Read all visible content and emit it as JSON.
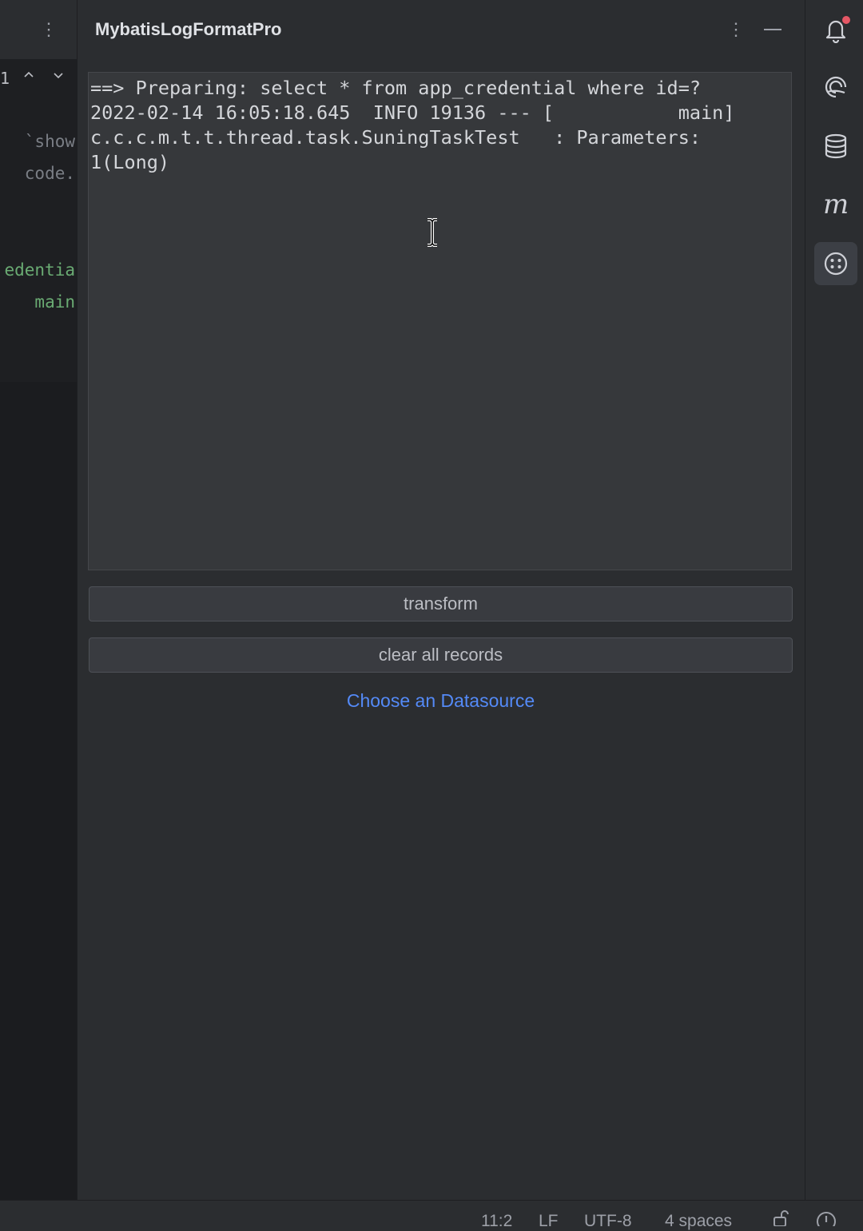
{
  "tool_window": {
    "title": "MybatisLogFormatPro"
  },
  "log_input": {
    "lines": [
      "==> Preparing: select * from app_credential where id=?",
      "2022-02-14 16:05:18.645  INFO 19136 --- [           main]",
      "c.c.c.m.t.t.thread.task.SuningTaskTest   : Parameters:",
      "1(Long)"
    ]
  },
  "buttons": {
    "transform": "transform",
    "clear": "clear all records"
  },
  "datasource_link": "Choose an Datasource",
  "editor_fragment": {
    "search_count": "1",
    "lines": [
      "`show",
      "code.",
      "edentia",
      "main"
    ]
  },
  "status_bar": {
    "position": "11:2",
    "line_ending": "LF",
    "encoding": "UTF-8",
    "indent": "4 spaces"
  },
  "right_stripe": {
    "icons": [
      "notifications-icon",
      "ai-assistant-icon",
      "database-icon",
      "maven-icon",
      "plugin-icon"
    ],
    "active": "plugin-icon"
  },
  "colors": {
    "link": "#548af7",
    "code_green": "#6aab73",
    "badge_red": "#e55765"
  }
}
